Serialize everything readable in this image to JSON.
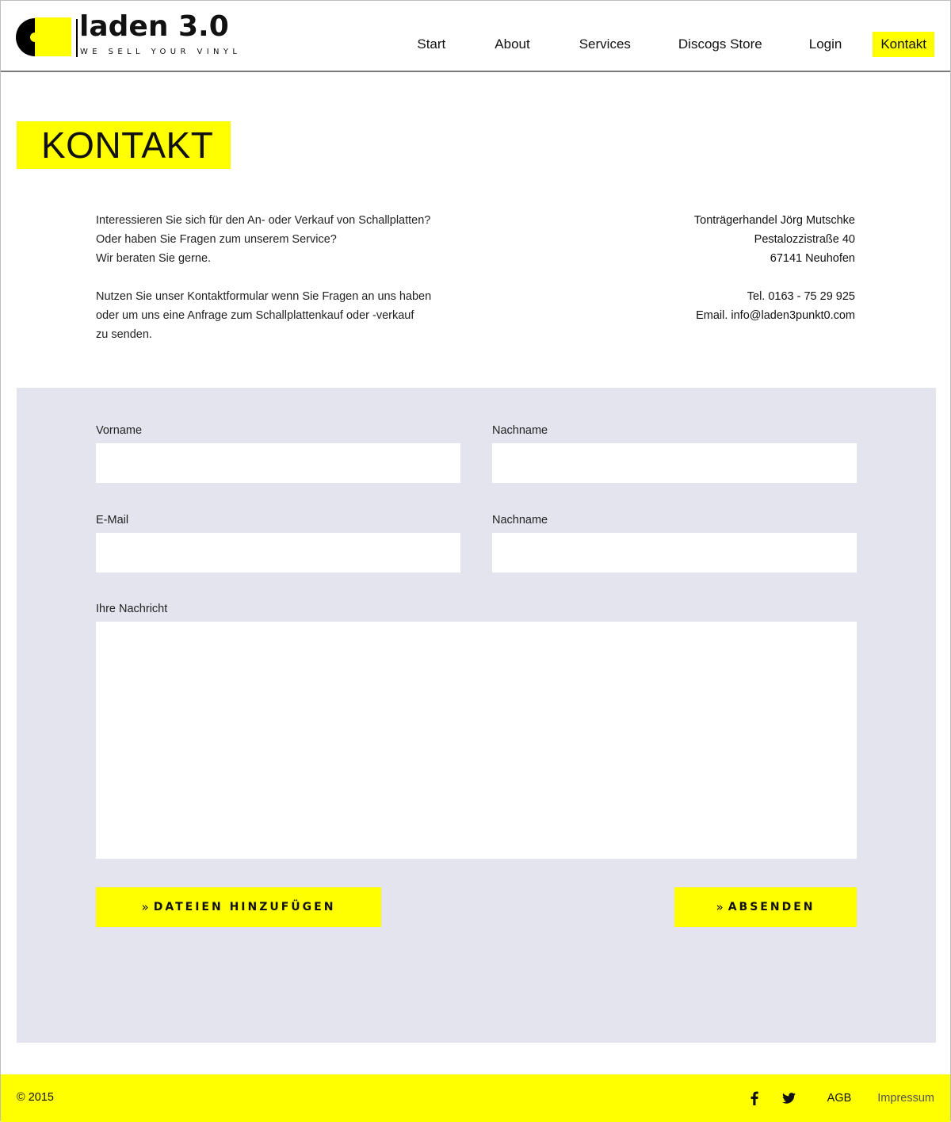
{
  "brand": {
    "name": "laden 3.0",
    "tagline": "WE SELL YOUR VINYL",
    "accent_color": "#ffff00",
    "panel_color": "#e4e4ef"
  },
  "nav": {
    "items": [
      {
        "label": "Start",
        "active": false
      },
      {
        "label": "About",
        "active": false
      },
      {
        "label": "Services",
        "active": false
      },
      {
        "label": "Discogs Store",
        "active": false
      },
      {
        "label": "Login",
        "active": false
      },
      {
        "label": "Kontakt",
        "active": true
      }
    ]
  },
  "page": {
    "title": "KONTAKT"
  },
  "intro": {
    "paragraph1": [
      "Interessieren Sie sich für den An- oder Verkauf von Schallplatten?",
      "Oder haben Sie Fragen zum unserem Service?",
      "Wir beraten Sie gerne."
    ],
    "paragraph2": [
      "Nutzen Sie unser Kontaktformular wenn Sie Fragen an uns haben",
      "oder um uns eine Anfrage zum Schallplattenkauf oder -verkauf",
      "zu senden."
    ]
  },
  "address": {
    "company": "Tonträgerhandel Jörg Mutschke",
    "street": "Pestalozzistraße 40",
    "city": "67141 Neuhofen",
    "phone": "Tel. 0163 - 75 29 925",
    "email": "Email. info@laden3punkt0.com"
  },
  "form": {
    "fields": {
      "vorname": {
        "label": "Vorname",
        "value": "",
        "placeholder": ""
      },
      "nachname": {
        "label": "Nachname",
        "value": "",
        "placeholder": ""
      },
      "email": {
        "label": "E-Mail",
        "value": "",
        "placeholder": ""
      },
      "nachname2": {
        "label": "Nachname",
        "value": "",
        "placeholder": ""
      },
      "message": {
        "label": "Ihre Nachricht",
        "value": "",
        "placeholder": ""
      }
    },
    "attach_button": {
      "icon": "double-chevron-right-icon",
      "chevron": "»",
      "label": "DATEIEN HINZUFÜGEN"
    },
    "submit_button": {
      "icon": "double-chevron-right-icon",
      "chevron": "»",
      "label": "ABSENDEN"
    }
  },
  "footer": {
    "copyright": "© 2015",
    "social": [
      {
        "icon": "facebook-icon"
      },
      {
        "icon": "twitter-icon"
      }
    ],
    "links": [
      {
        "label": "AGB"
      },
      {
        "label": "Impressum"
      }
    ]
  }
}
